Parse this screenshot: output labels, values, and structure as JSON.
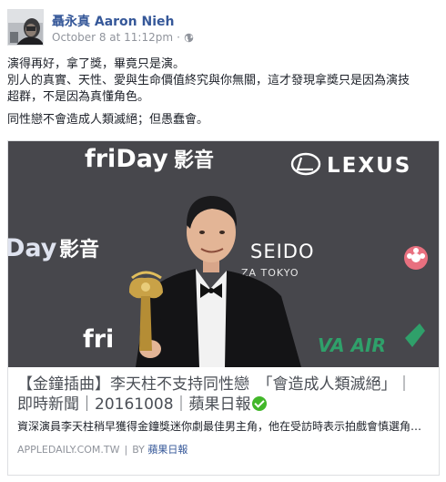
{
  "post": {
    "author": "聶永真 Aaron Nieh",
    "timestamp": "October 8 at 11:12pm",
    "meta_separator": "·",
    "privacy_icon": "globe-icon",
    "body": {
      "paragraph_1": {
        "line_1": "演得再好，拿了獎，畢竟只是演。",
        "line_2": "別人的真實、天性、愛與生命價值終究與你無關，這才發現拿獎只是因為演技",
        "line_3": "超群，不是因為真懂角色。"
      },
      "paragraph_2": "同性戀不會造成人類滅絕；但愚蠢會。"
    }
  },
  "card": {
    "image": {
      "sign_friday": "friDay",
      "sign_yingyin": "影音",
      "sign_lexus": "LEXUS",
      "sign_day2": "Day",
      "sign_yingyin2": "影音",
      "sign_seido": "SEIDO",
      "sign_tokyo": "ZA TOKYO",
      "sign_fri": "fri",
      "sign_eva": "VA AIR"
    },
    "title_line_1": "【金鐘插曲】李天柱不支持同性戀　「會造成人類滅絕」｜",
    "title_line_2": "即時新聞｜20161008｜蘋果日報",
    "description": "資深演員李天柱稍早獲得金鐘獎迷你劇最佳男主角，他在受訪時表示拍戲會慎選角…",
    "source_domain": "APPLEDAILY.COM.TW",
    "source_separator": "|",
    "by_label": "BY",
    "by_name": "蘋果日報"
  },
  "colors": {
    "author_link": "#365899",
    "meta_gray": "#90949c",
    "verified_green": "#42b72a",
    "card_border": "#dddfe2"
  }
}
